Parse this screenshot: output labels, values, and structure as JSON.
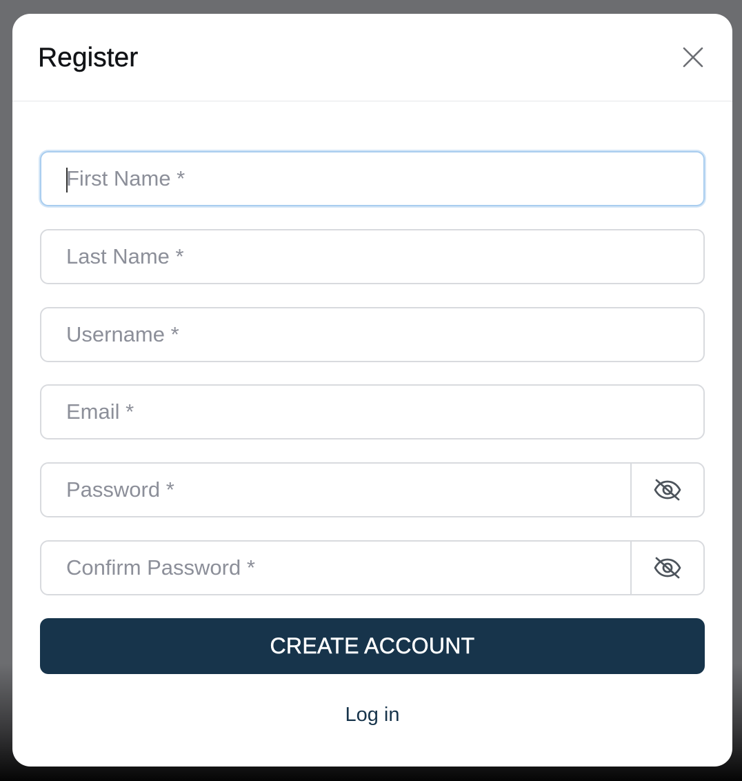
{
  "modal": {
    "title": "Register",
    "close_icon": "close-icon"
  },
  "form": {
    "first_name": {
      "placeholder": "First Name *",
      "value": "",
      "focused": true
    },
    "last_name": {
      "placeholder": "Last Name *",
      "value": ""
    },
    "username": {
      "placeholder": "Username *",
      "value": ""
    },
    "email": {
      "placeholder": "Email *",
      "value": ""
    },
    "password": {
      "placeholder": "Password *",
      "value": "",
      "toggle_icon": "eye-slash-icon"
    },
    "confirm_password": {
      "placeholder": "Confirm Password *",
      "value": "",
      "toggle_icon": "eye-slash-icon"
    },
    "submit_label": "CREATE ACCOUNT",
    "login_link_label": "Log in"
  },
  "colors": {
    "primary": "#17344b",
    "focus_border": "#a9cdef",
    "input_border": "#d8dade",
    "placeholder": "#8c8f99",
    "backdrop": "#6c6d70"
  }
}
